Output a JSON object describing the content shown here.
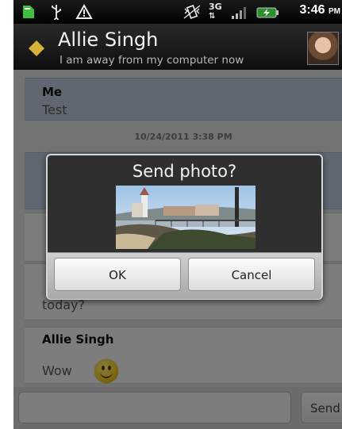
{
  "status_bar": {
    "network": "3G",
    "time": "3:46",
    "ampm": "PM",
    "icons": [
      "sim-icon",
      "usb-icon",
      "warning-icon",
      "vibrate-icon",
      "network-3g-icon",
      "signal-icon",
      "battery-icon"
    ]
  },
  "header": {
    "name": "Allie Singh",
    "status": "I am away from my computer now",
    "presence_color": "#d7b23b"
  },
  "messages": [
    {
      "sender": "Me",
      "body": "Test"
    },
    {
      "sender": "",
      "body": ""
    },
    {
      "sender": "",
      "body": ""
    },
    {
      "sender": "",
      "body": "today?"
    },
    {
      "sender": "Allie Singh",
      "body": "Wow"
    }
  ],
  "date_separator": "10/24/2011 3:38 PM",
  "compose": {
    "placeholder": "",
    "send_label": "Send"
  },
  "dialog": {
    "title": "Send photo?",
    "ok_label": "OK",
    "cancel_label": "Cancel"
  }
}
